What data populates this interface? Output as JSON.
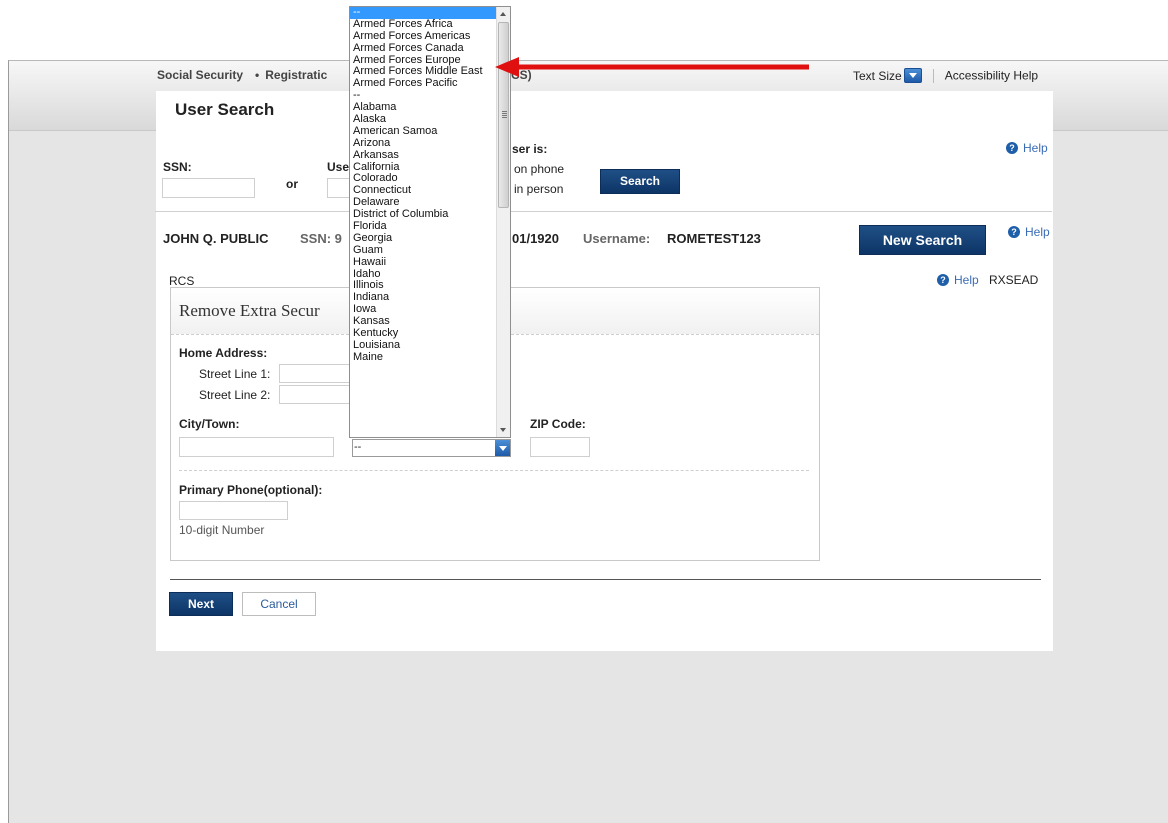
{
  "nav": {
    "left": [
      "Social Security",
      "•",
      "Registratic"
    ],
    "left_tail": "CS)",
    "text_size_label": "Text Size",
    "accessibility_label": "Accessibility Help"
  },
  "page_title": "User Search",
  "search": {
    "ssn_label": "SSN:",
    "or_label": "or",
    "username_label_partial": "Use",
    "user_is_label": "ser is:",
    "on_phone": "on phone",
    "in_person": "in person",
    "search_button": "Search",
    "help": "Help"
  },
  "user_info": {
    "name": "JOHN Q. PUBLIC",
    "ssn_label": "SSN: 9",
    "dob_partial": "01/1920",
    "username_label": "Username:",
    "username_value": "ROMETEST123",
    "new_search_button": "New Search",
    "help": "Help"
  },
  "rcs_label": "RCS",
  "rxsead_help": "Help",
  "rxsead_code": "RXSEAD",
  "form": {
    "title_partial": "Remove Extra Secur",
    "home_address": "Home Address:",
    "street1": "Street Line 1:",
    "street2": "Street Line 2:",
    "city": "City/Town:",
    "zip": "ZIP Code:",
    "state_value": "--",
    "phone_label": "Primary Phone(optional):",
    "phone_hint": "10-digit Number"
  },
  "buttons": {
    "next": "Next",
    "cancel": "Cancel"
  },
  "dropdown": {
    "selected_index": 0,
    "items": [
      "--",
      "Armed Forces Africa",
      "Armed Forces Americas",
      "Armed Forces Canada",
      "Armed Forces Europe",
      "Armed Forces Middle East",
      "Armed Forces Pacific",
      "--",
      "Alabama",
      "Alaska",
      "American Samoa",
      "Arizona",
      "Arkansas",
      "California",
      "Colorado",
      "Connecticut",
      "Delaware",
      "District of Columbia",
      "Florida",
      "Georgia",
      "Guam",
      "Hawaii",
      "Idaho",
      "Illinois",
      "Indiana",
      "Iowa",
      "Kansas",
      "Kentucky",
      "Louisiana",
      "Maine"
    ]
  },
  "colors": {
    "annotation_arrow": "#e01010",
    "primary_button": "#0d3566",
    "help_icon": "#1f5fa9",
    "selected_option": "#3399ff"
  }
}
